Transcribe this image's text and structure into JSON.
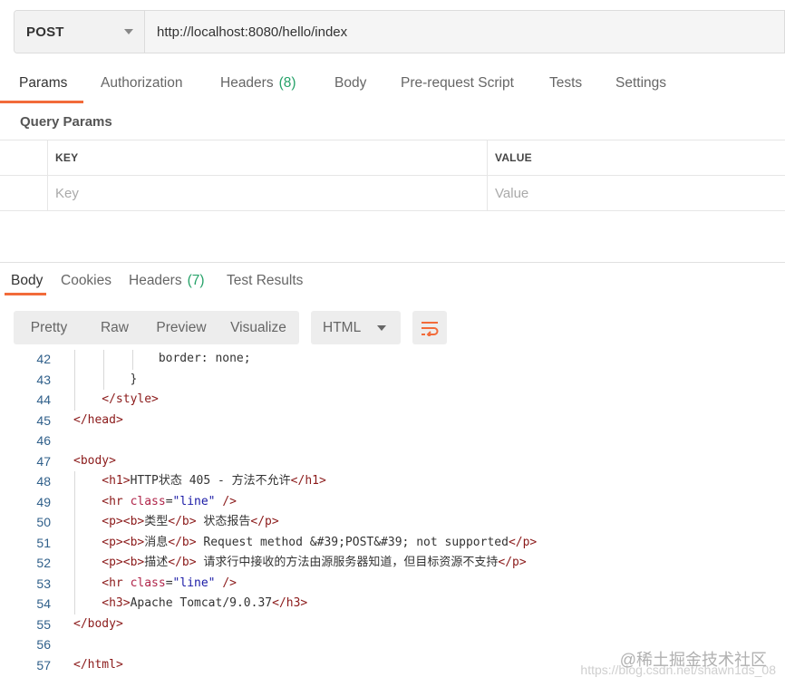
{
  "request": {
    "method": "POST",
    "url": "http://localhost:8080/hello/index"
  },
  "request_tabs": [
    {
      "label": "Params",
      "count": "",
      "active": true
    },
    {
      "label": "Authorization",
      "count": ""
    },
    {
      "label": "Headers",
      "count": "(8)"
    },
    {
      "label": "Body",
      "count": ""
    },
    {
      "label": "Pre-request Script",
      "count": ""
    },
    {
      "label": "Tests",
      "count": ""
    },
    {
      "label": "Settings",
      "count": ""
    }
  ],
  "query_params": {
    "title": "Query Params",
    "key_header": "KEY",
    "value_header": "VALUE",
    "key_placeholder": "Key",
    "value_placeholder": "Value"
  },
  "response_tabs": [
    {
      "label": "Body",
      "count": "",
      "active": true
    },
    {
      "label": "Cookies",
      "count": ""
    },
    {
      "label": "Headers",
      "count": "(7)"
    },
    {
      "label": "Test Results",
      "count": ""
    }
  ],
  "view_modes": [
    "Pretty",
    "Raw",
    "Preview",
    "Visualize"
  ],
  "view_mode_selected": "Pretty",
  "language": "HTML",
  "icons": {
    "method_dropdown": "chevron-down-icon",
    "language_dropdown": "chevron-down-icon",
    "wrap": "wrap-lines-icon"
  },
  "colors": {
    "accent": "#f26b3a",
    "count": "#26a269",
    "tag": "#8b1a1a",
    "attr_name": "#b0254a",
    "attr_value": "#1a1aa6",
    "line_number": "#2f5f8a"
  },
  "code_lines": [
    {
      "n": "42",
      "indent": 3,
      "html": "border: none;"
    },
    {
      "n": "43",
      "indent": 2,
      "html": "}"
    },
    {
      "n": "44",
      "indent": 1,
      "html": "<span class=\"t\">&lt;/style&gt;</span>"
    },
    {
      "n": "45",
      "indent": 0,
      "html": "<span class=\"t\">&lt;/head&gt;</span>"
    },
    {
      "n": "46",
      "indent": 0,
      "html": ""
    },
    {
      "n": "47",
      "indent": 0,
      "html": "<span class=\"t\">&lt;body&gt;</span>"
    },
    {
      "n": "48",
      "indent": 1,
      "html": "<span class=\"t\">&lt;h1&gt;</span>HTTP状态 405 - 方法不允许<span class=\"t\">&lt;/h1&gt;</span>"
    },
    {
      "n": "49",
      "indent": 1,
      "html": "<span class=\"t\">&lt;hr</span> <span class=\"a\">class</span>=<span class=\"v\">\"line\"</span> <span class=\"t\">/&gt;</span>"
    },
    {
      "n": "50",
      "indent": 1,
      "html": "<span class=\"t\">&lt;p&gt;&lt;b&gt;</span>类型<span class=\"t\">&lt;/b&gt;</span> 状态报告<span class=\"t\">&lt;/p&gt;</span>"
    },
    {
      "n": "51",
      "indent": 1,
      "html": "<span class=\"t\">&lt;p&gt;&lt;b&gt;</span>消息<span class=\"t\">&lt;/b&gt;</span> Request method &amp;#39;POST&amp;#39; not supported<span class=\"t\">&lt;/p&gt;</span>"
    },
    {
      "n": "52",
      "indent": 1,
      "html": "<span class=\"t\">&lt;p&gt;&lt;b&gt;</span>描述<span class=\"t\">&lt;/b&gt;</span> 请求行中接收的方法由源服务器知道，但目标资源不支持<span class=\"t\">&lt;/p&gt;</span>"
    },
    {
      "n": "53",
      "indent": 1,
      "html": "<span class=\"t\">&lt;hr</span> <span class=\"a\">class</span>=<span class=\"v\">\"line\"</span> <span class=\"t\">/&gt;</span>"
    },
    {
      "n": "54",
      "indent": 1,
      "html": "<span class=\"t\">&lt;h3&gt;</span>Apache Tomcat/9.0.37<span class=\"t\">&lt;/h3&gt;</span>"
    },
    {
      "n": "55",
      "indent": 0,
      "html": "<span class=\"t\">&lt;/body&gt;</span>"
    },
    {
      "n": "56",
      "indent": 0,
      "html": ""
    },
    {
      "n": "57",
      "indent": 0,
      "html": "<span class=\"t\">&lt;/html&gt;</span>"
    }
  ],
  "watermark": {
    "line1": "@稀土掘金技术社区",
    "line2": "https://blog.csdn.net/shawn1ds_08"
  }
}
